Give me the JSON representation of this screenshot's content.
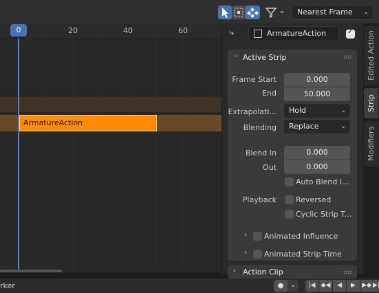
{
  "header": {
    "filter_chevron": "⌄",
    "snap_mode": "Nearest Frame"
  },
  "timeline": {
    "current_frame": "0",
    "ticks": [
      "20",
      "40",
      "60"
    ]
  },
  "track": {
    "strip_label": "ArmatureAction"
  },
  "sidebar": {
    "action_name": "ArmatureAction",
    "active_strip": {
      "title": "Active Strip",
      "frame_start_label": "Frame Start",
      "frame_start_value": "0.000",
      "end_label": "End",
      "end_value": "50.000",
      "extrapolation_label": "Extrapolati...",
      "extrapolation_value": "Hold",
      "blending_label": "Blending",
      "blending_value": "Replace",
      "blend_in_label": "Blend In",
      "blend_in_value": "0.000",
      "out_label": "Out",
      "out_value": "0.000",
      "auto_blend_label": "Auto Blend I...",
      "playback_label": "Playback",
      "reversed_label": "Reversed",
      "cyclic_label": "Cyclic Strip T...",
      "animated_influence_label": "Animated Influence",
      "animated_strip_time_label": "Animated Strip Time"
    },
    "action_clip": {
      "title": "Action Clip"
    }
  },
  "tabs": [
    "Edited Action",
    "Strip",
    "Modifiers"
  ],
  "footer": {
    "label": "rker",
    "record_icon": "●",
    "jump_start": "|◀",
    "prev_key": "◆◀",
    "play_reverse": "◀",
    "play": "▶",
    "next_key": "▶◆",
    "jump_end": "▶|"
  }
}
